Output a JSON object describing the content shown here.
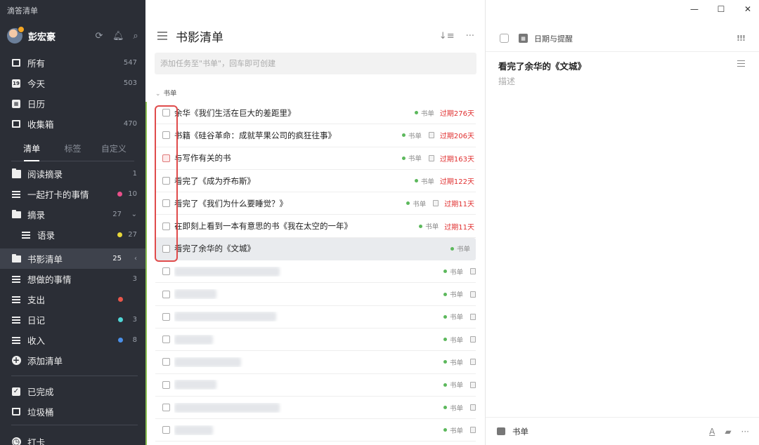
{
  "app": {
    "title": "滴答清单"
  },
  "user": {
    "name": "彭宏豪"
  },
  "smart_lists": [
    {
      "label": "所有",
      "count": "547",
      "icon": "inbox-stack-icon"
    },
    {
      "label": "今天",
      "count": "503",
      "icon": "calendar-today-icon"
    },
    {
      "label": "日历",
      "count": "",
      "icon": "calendar-icon"
    },
    {
      "label": "收集箱",
      "count": "470",
      "icon": "inbox-icon"
    }
  ],
  "sidebar_tabs": [
    "清单",
    "标签",
    "自定义"
  ],
  "lists": [
    {
      "label": "阅读摘录",
      "count": "1",
      "dot": ""
    },
    {
      "label": "一起打卡的事情",
      "count": "10",
      "dot": "#e94f8a"
    },
    {
      "label": "摘录",
      "count": "27",
      "dot": ""
    },
    {
      "label": "语录",
      "count": "27",
      "dot": "#e8d73a"
    },
    {
      "label": "书影清单",
      "count": "25",
      "dot": ""
    },
    {
      "label": "想做的事情",
      "count": "3",
      "dot": ""
    },
    {
      "label": "支出",
      "count": "",
      "dot": "#e8564a"
    },
    {
      "label": "日记",
      "count": "3",
      "dot": "#4fd6d6"
    },
    {
      "label": "收入",
      "count": "8",
      "dot": "#4a8fe8"
    }
  ],
  "add_list_label": "添加清单",
  "bottom_items": [
    "已完成",
    "垃圾桶",
    "打卡"
  ],
  "colors": {
    "sidebar_bg": "#2b2e36",
    "accent_green": "#5cb85c",
    "overdue_red": "#e03030",
    "highlight_red": "#e04b4b"
  },
  "main": {
    "title": "书影清单",
    "add_placeholder": "添加任务至\"书单\"，回车即可创建",
    "section": "书单"
  },
  "tasks": [
    {
      "title": "余华《我们生活在巨大的差距里》",
      "tag": "书单",
      "due": "过期276天",
      "note": false
    },
    {
      "title": "书籍《硅谷革命：成就苹果公司的疯狂往事》",
      "tag": "书单",
      "due": "过期206天",
      "note": true
    },
    {
      "title": "与写作有关的书",
      "tag": "书单",
      "due": "过期163天",
      "note": true
    },
    {
      "title": "看完了《成为乔布斯》",
      "tag": "书单",
      "due": "过期122天",
      "note": false
    },
    {
      "title": "看完了《我们为什么要睡觉？》",
      "tag": "书单",
      "due": "过期11天",
      "note": true
    },
    {
      "title": "在即刻上看到一本有意思的书《我在太空的一年》",
      "tag": "书单",
      "due": "过期11天",
      "note": false
    },
    {
      "title": "看完了余华的《文城》",
      "tag": "书单",
      "due": "",
      "note": false
    }
  ],
  "blurred_tasks_tag": "书单",
  "detail": {
    "date_label": "日期与提醒",
    "priority": "!!!",
    "title": "看完了余华的《文城》",
    "description_placeholder": "描述",
    "list_name": "书单"
  }
}
